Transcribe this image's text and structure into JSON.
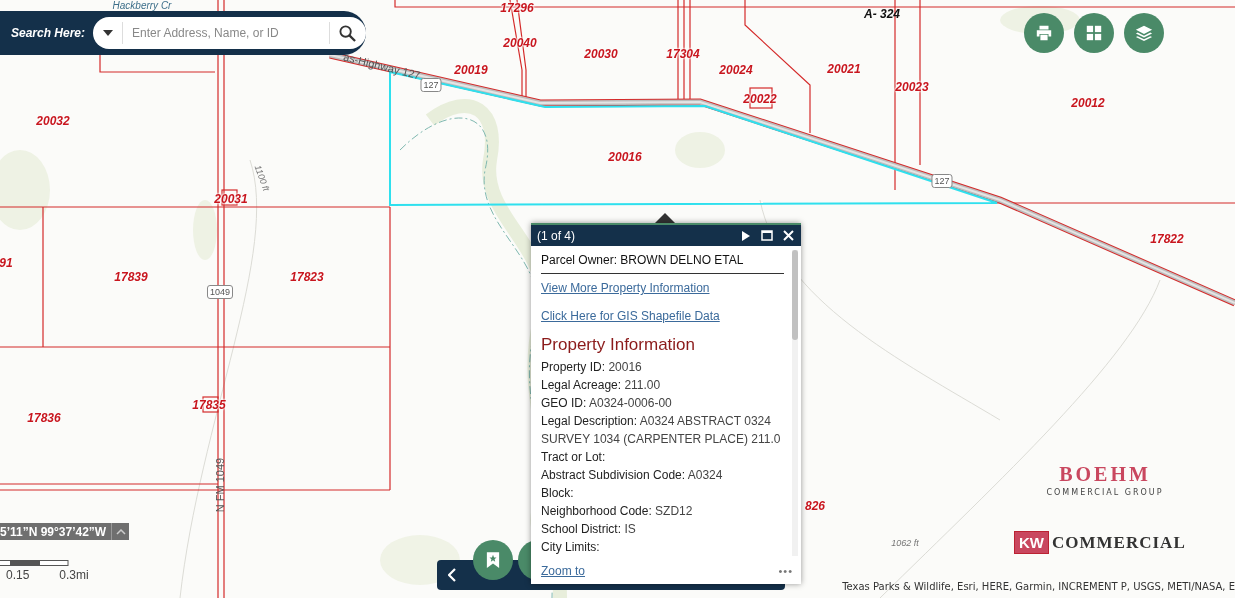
{
  "search": {
    "label": "Search Here:",
    "placeholder": "Enter Address, Name, or ID"
  },
  "map_labels": [
    {
      "text": "17296",
      "kind": "parcel"
    },
    {
      "text": "20040",
      "kind": "parcel"
    },
    {
      "text": "20030",
      "kind": "parcel"
    },
    {
      "text": "17304",
      "kind": "parcel"
    },
    {
      "text": "20024",
      "kind": "parcel"
    },
    {
      "text": "20021",
      "kind": "parcel"
    },
    {
      "text": "20023",
      "kind": "parcel"
    },
    {
      "text": "20019",
      "kind": "parcel"
    },
    {
      "text": "20022",
      "kind": "parcel"
    },
    {
      "text": "20012",
      "kind": "parcel"
    },
    {
      "text": "20032",
      "kind": "parcel"
    },
    {
      "text": "20016",
      "kind": "parcel"
    },
    {
      "text": "20031",
      "kind": "parcel"
    },
    {
      "text": "17822",
      "kind": "parcel"
    },
    {
      "text": "91",
      "kind": "parcel"
    },
    {
      "text": "17839",
      "kind": "parcel"
    },
    {
      "text": "17823",
      "kind": "parcel"
    },
    {
      "text": "17835",
      "kind": "parcel"
    },
    {
      "text": "17836",
      "kind": "parcel"
    },
    {
      "text": "826",
      "kind": "parcel"
    },
    {
      "text": "A- 324",
      "kind": "survey"
    },
    {
      "text": "127",
      "kind": "shield"
    },
    {
      "text": "127",
      "kind": "shield"
    },
    {
      "text": "1049",
      "kind": "shield"
    },
    {
      "text": "as-Highway 127",
      "kind": "road"
    },
    {
      "text": "N FM 1049",
      "kind": "road"
    },
    {
      "text": "1100 ft",
      "kind": "contour"
    },
    {
      "text": "1062 ft",
      "kind": "contour"
    },
    {
      "text": "Hackberry Cr",
      "kind": "water"
    }
  ],
  "coordinates": "5’11”N 99°37’42”W",
  "scale": [
    "0.15",
    "0.3mi"
  ],
  "popup": {
    "counter": "(1 of 4)",
    "owner": "Parcel Owner: BROWN DELNO ETAL",
    "links": [
      "View More Property Information",
      "Click Here for GIS Shapefile Data"
    ],
    "section_title": "Property Information",
    "fields": [
      {
        "label": "Property ID:",
        "value": "20016"
      },
      {
        "label": "Legal Acreage:",
        "value": "211.00"
      },
      {
        "label": "GEO ID:",
        "value": "A0324-0006-00"
      },
      {
        "label": "Legal Description:",
        "value": "A0324 ABSTRACT 0324 SURVEY 1034 (CARPENTER PLACE) 211.0"
      },
      {
        "label": "Tract or Lot:"
      },
      {
        "label": "Abstract Subdivision Code:",
        "value": "A0324"
      },
      {
        "label": "Block:"
      },
      {
        "label": "Neighborhood Code:",
        "value": "SZD12"
      },
      {
        "label": "School District:",
        "value": "IS"
      },
      {
        "label": "City Limits:"
      }
    ],
    "zoom_link": "Zoom to",
    "more": "•••"
  },
  "logos": {
    "boehm": "BOEHM",
    "boehm_sub": "COMMERCIAL GROUP",
    "kw": "KW",
    "kw_name": "COMMERCIAL"
  },
  "attribution": "Texas Parks & Wildlife, Esri, HERE, Garmin, INCREMENT P, USGS, METI/NASA, E"
}
